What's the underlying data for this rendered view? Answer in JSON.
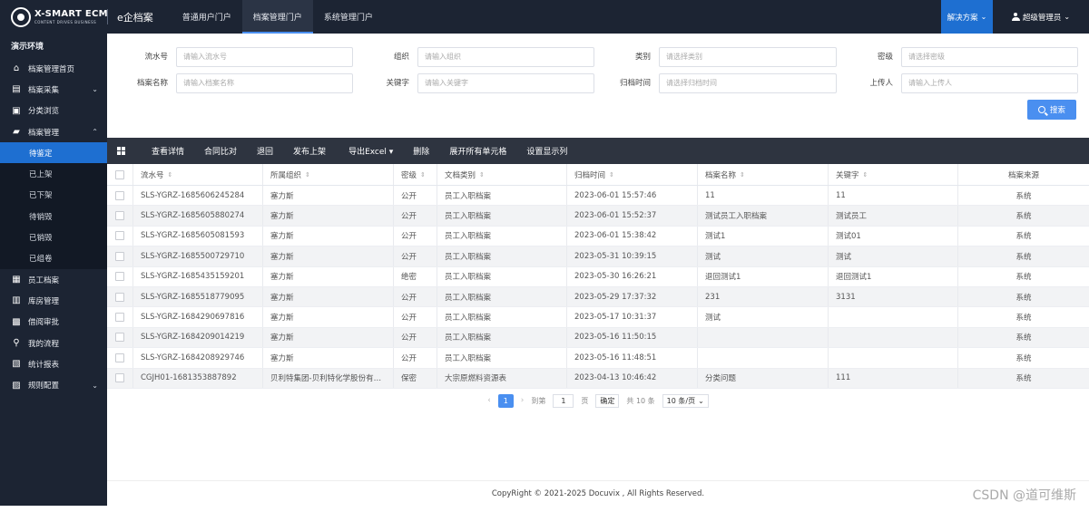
{
  "topbar": {
    "logo_main": "X-SMART ECM",
    "logo_sub": "CONTENT DRIVES BUSINESS",
    "app_name": "e企档案",
    "nav": [
      "普通用户门户",
      "档案管理门户",
      "系统管理门户"
    ],
    "solution": "解决方案",
    "user": "超级管理员"
  },
  "sidebar": {
    "env": "演示环境",
    "items": [
      {
        "label": "档案管理首页",
        "icon": "home-icon"
      },
      {
        "label": "档案采集",
        "icon": "collect-icon",
        "caret": "⌄"
      },
      {
        "label": "分类浏览",
        "icon": "category-icon"
      },
      {
        "label": "档案管理",
        "icon": "folder-icon",
        "caret": "⌃"
      }
    ],
    "subitems": [
      "待鉴定",
      "已上架",
      "已下架",
      "待销毁",
      "已销毁",
      "已组卷"
    ],
    "items2": [
      {
        "label": "员工档案",
        "icon": "employee-icon"
      },
      {
        "label": "库房管理",
        "icon": "warehouse-icon"
      },
      {
        "label": "借阅审批",
        "icon": "approval-icon"
      },
      {
        "label": "我的流程",
        "icon": "flow-icon"
      },
      {
        "label": "统计报表",
        "icon": "report-icon"
      },
      {
        "label": "规则配置",
        "icon": "rules-icon",
        "caret": "⌄"
      }
    ]
  },
  "filters": {
    "row1": [
      {
        "label": "流水号",
        "placeholder": "请输入流水号"
      },
      {
        "label": "组织",
        "placeholder": "请输入组织"
      },
      {
        "label": "类别",
        "placeholder": "请选择类别"
      },
      {
        "label": "密级",
        "placeholder": "请选择密级"
      }
    ],
    "row2": [
      {
        "label": "档案名称",
        "placeholder": "请输入档案名称"
      },
      {
        "label": "关键字",
        "placeholder": "请输入关键字"
      },
      {
        "label": "归档时间",
        "placeholder": "请选择归档时间"
      },
      {
        "label": "上传人",
        "placeholder": "请输入上传人"
      }
    ],
    "search_label": "搜索"
  },
  "toolbar": [
    "查看详情",
    "合同比对",
    "退回",
    "发布上架",
    "导出Excel ▾",
    "删除",
    "展开所有单元格",
    "设置显示列"
  ],
  "table": {
    "headers": [
      "流水号",
      "所属组织",
      "密级",
      "文档类别",
      "归档时间",
      "档案名称",
      "关键字",
      "档案来源"
    ],
    "rows": [
      [
        "SLS-YGRZ-1685606245284",
        "塞力斯",
        "公开",
        "员工入职档案",
        "2023-06-01 15:57:46",
        "11",
        "11",
        "系统"
      ],
      [
        "SLS-YGRZ-1685605880274",
        "塞力斯",
        "公开",
        "员工入职档案",
        "2023-06-01 15:52:37",
        "测试员工入职档案",
        "测试员工",
        "系统"
      ],
      [
        "SLS-YGRZ-1685605081593",
        "塞力斯",
        "公开",
        "员工入职档案",
        "2023-06-01 15:38:42",
        "测试1",
        "测试01",
        "系统"
      ],
      [
        "SLS-YGRZ-1685500729710",
        "塞力斯",
        "公开",
        "员工入职档案",
        "2023-05-31 10:39:15",
        "测试",
        "测试",
        "系统"
      ],
      [
        "SLS-YGRZ-1685435159201",
        "塞力斯",
        "绝密",
        "员工入职档案",
        "2023-05-30 16:26:21",
        "退回测试1",
        "退回测试1",
        "系统"
      ],
      [
        "SLS-YGRZ-1685518779095",
        "塞力斯",
        "公开",
        "员工入职档案",
        "2023-05-29 17:37:32",
        "231",
        "3131",
        "系统"
      ],
      [
        "SLS-YGRZ-1684290697816",
        "塞力斯",
        "公开",
        "员工入职档案",
        "2023-05-17 10:31:37",
        "测试",
        "",
        "系统"
      ],
      [
        "SLS-YGRZ-1684209014219",
        "塞力斯",
        "公开",
        "员工入职档案",
        "2023-05-16 11:50:15",
        "",
        "",
        "系统"
      ],
      [
        "SLS-YGRZ-1684208929746",
        "塞力斯",
        "公开",
        "员工入职档案",
        "2023-05-16 11:48:51",
        "",
        "",
        "系统"
      ],
      [
        "CGJH01-1681353887892",
        "贝利特集团-贝利特化学股份有…",
        "保密",
        "大宗原燃料资源表",
        "2023-04-13 10:46:42",
        "分类问题",
        "111",
        "系统"
      ]
    ]
  },
  "pager": {
    "current": "1",
    "goto_label": "到第",
    "goto_value": "1",
    "page_unit": "页",
    "confirm": "确定",
    "total": "共 10 条",
    "size": "10 条/页"
  },
  "footer": "CopyRight © 2021-2025 Docuvix , All Rights Reserved.",
  "watermark": "CSDN @道可维斯"
}
